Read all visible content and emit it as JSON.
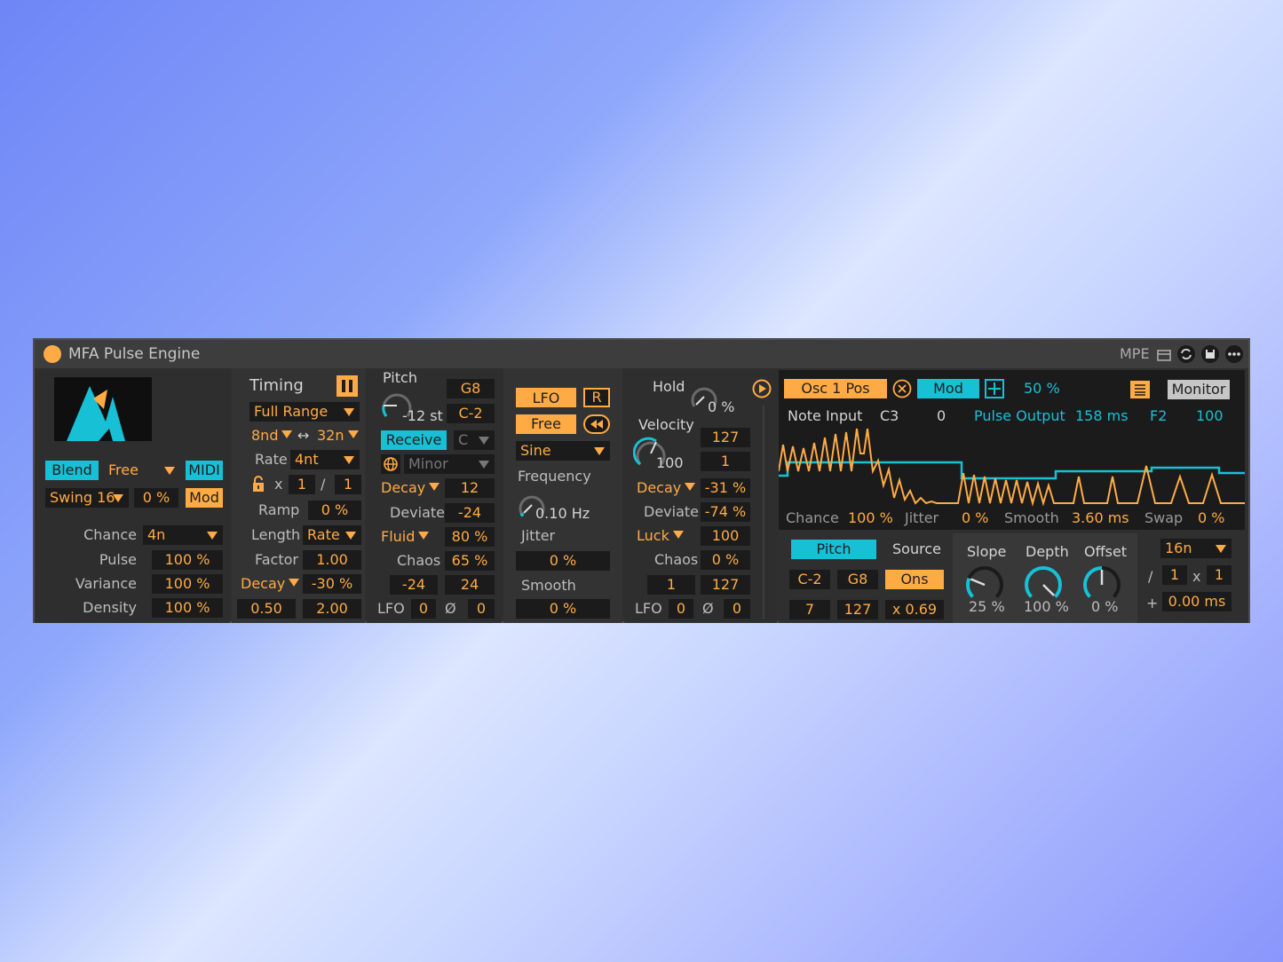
{
  "device": {
    "title": "MFA Pulse Engine",
    "mpe_label": "MPE"
  },
  "left": {
    "blend": "Blend",
    "free": "Free",
    "midi": "MIDI",
    "swing": "Swing 16",
    "swing_val": "0 %",
    "mod": "Mod",
    "params": [
      {
        "label": "Chance",
        "value": "4n"
      },
      {
        "label": "Pulse",
        "value": "100 %"
      },
      {
        "label": "Variance",
        "value": "100 %"
      },
      {
        "label": "Density",
        "value": "100 %"
      }
    ]
  },
  "timing": {
    "title": "Timing",
    "range": "Full Range",
    "rate_a": "8nd",
    "rate_b": "32n",
    "rate_label": "Rate",
    "rate_val": "4nt",
    "x_label": "x",
    "mult": "1",
    "div_label": "/",
    "div": "1",
    "ramp_label": "Ramp",
    "ramp_val": "0 %",
    "length_label": "Length",
    "length_val": "Rate",
    "factor_label": "Factor",
    "factor_val": "1.00",
    "decay": "Decay",
    "decay_val": "-30 %",
    "min": "0.50",
    "max": "2.00"
  },
  "pitch": {
    "title": "Pitch",
    "high": "G8",
    "semis": "-12 st",
    "low": "C-2",
    "receive": "Receive",
    "key": "C",
    "scale": "Minor",
    "decay": "Decay",
    "decay_val": "12",
    "deviate_label": "Deviate",
    "deviate_val": "-24",
    "fluid": "Fluid",
    "fluid_val": "80 %",
    "chaos_label": "Chaos",
    "chaos_val": "65 %",
    "range_lo": "-24",
    "range_hi": "24",
    "lfo_label": "LFO",
    "lfo_val": "0",
    "phase_label": "Ø",
    "phase_val": "0"
  },
  "lfo": {
    "lfo": "LFO",
    "r": "R",
    "free": "Free",
    "shape": "Sine",
    "freq_label": "Frequency",
    "freq_val": "0.10 Hz",
    "jitter_label": "Jitter",
    "jitter_val": "0 %",
    "smooth_label": "Smooth",
    "smooth_val": "0 %"
  },
  "velocity": {
    "hold_label": "Hold",
    "hold_val": "0 %",
    "vel_label": "Velocity",
    "vel_knob": "100",
    "vel_max": "127",
    "vel_min": "1",
    "decay": "Decay",
    "decay_val": "-31 %",
    "deviate_label": "Deviate",
    "deviate_val": "-74 %",
    "luck": "Luck",
    "luck_val": "100",
    "chaos_label": "Chaos",
    "chaos_val": "0 %",
    "range_lo": "1",
    "range_hi": "127",
    "lfo_label": "LFO",
    "lfo_val": "0",
    "phase_label": "Ø",
    "phase_val": "0"
  },
  "monitor": {
    "target": "Osc 1 Pos",
    "mod": "Mod",
    "amount": "50 %",
    "monitor": "Monitor",
    "note_input": "Note Input",
    "note": "C3",
    "note_vel": "0",
    "pulse_output": "Pulse Output",
    "pulse_ms": "158 ms",
    "out_note": "F2",
    "out_vel": "100",
    "stats": [
      {
        "label": "Chance",
        "value": "100 %"
      },
      {
        "label": "Jitter",
        "value": "0 %"
      },
      {
        "label": "Smooth",
        "value": "3.60 ms"
      },
      {
        "label": "Swap",
        "value": "0 %"
      }
    ],
    "pitch_btn": "Pitch",
    "source_label": "Source",
    "lo": "C-2",
    "hi": "G8",
    "ons": "Ons",
    "v_lo": "7",
    "v_hi": "127",
    "mult": "x 0.69"
  },
  "env": {
    "slope_label": "Slope",
    "slope_val": "25 %",
    "slope_frac": 0.25,
    "depth_label": "Depth",
    "depth_val": "100 %",
    "depth_frac": 1.0,
    "offset_label": "Offset",
    "offset_val": "0 %",
    "offset_frac": 0.5
  },
  "out": {
    "rate": "16n",
    "div_label": "/",
    "div": "1",
    "x_label": "x",
    "mult": "1",
    "plus_label": "+",
    "offset": "0.00 ms"
  }
}
